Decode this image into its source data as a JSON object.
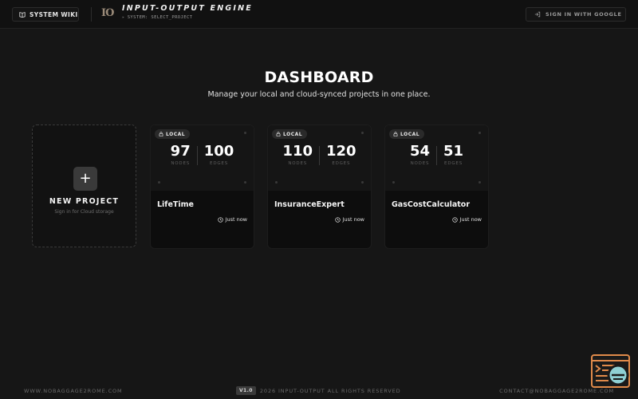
{
  "header": {
    "wiki_label": "SYSTEM WIKI",
    "logo_text": "IO",
    "title": "INPUT-OUTPUT ENGINE",
    "subtitle": "SYSTEM: SELECT_PROJECT",
    "subtitle_bullet": "▸",
    "signin_label": "SIGN IN WITH GOOGLE"
  },
  "main": {
    "title": "DASHBOARD",
    "subtitle": "Manage your local and cloud-synced projects in one place."
  },
  "new_project": {
    "icon": "+",
    "label": "NEW PROJECT",
    "sub": "Sign in for Cloud storage"
  },
  "projects": [
    {
      "badge": "LOCAL",
      "nodes": "97",
      "nodes_label": "NODES",
      "edges": "100",
      "edges_label": "EDGES",
      "name": "LifeTime",
      "time": "Just now"
    },
    {
      "badge": "LOCAL",
      "nodes": "110",
      "nodes_label": "NODES",
      "edges": "120",
      "edges_label": "EDGES",
      "name": "InsuranceExpert",
      "time": "Just now"
    },
    {
      "badge": "LOCAL",
      "nodes": "54",
      "nodes_label": "NODES",
      "edges": "51",
      "edges_label": "EDGES",
      "name": "GasCostCalculator",
      "time": "Just now"
    }
  ],
  "footer": {
    "left": "WWW.NOBAGGAGE2ROME.COM",
    "version": "V1.0",
    "copyright": "2026 INPUT-OUTPUT ALL RIGHTS RESERVED",
    "right": "CONTACT@NOBAGGAGE2ROME.COM"
  },
  "icons": {
    "wiki": "book-icon",
    "signin": "login-icon",
    "badge": "lock-icon",
    "time": "clock-icon",
    "widget": "console-widget-icon"
  },
  "colors": {
    "background": "#161616",
    "header": "#111111",
    "card": "#0d0d0d",
    "widget_accent": "#e08a4a",
    "widget_teal": "#8fd0d4"
  }
}
